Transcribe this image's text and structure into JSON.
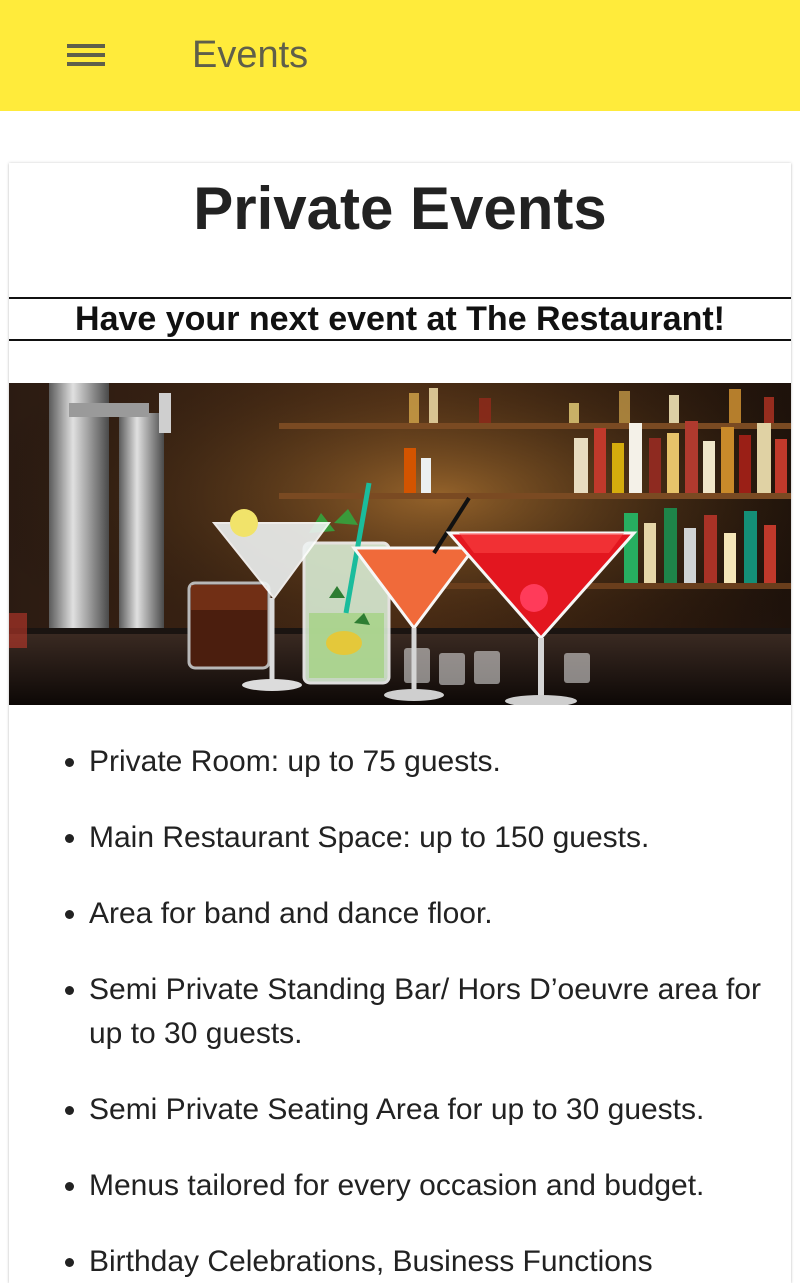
{
  "appbar": {
    "title": "Events",
    "bg_color": "#ffeb3b",
    "menu_icon": "hamburger-menu-icon"
  },
  "page": {
    "title": "Private Events",
    "subtitle": "Have your next event at The Restaurant!"
  },
  "features": [
    "Private Room: up to 75 guests.",
    "Main Restaurant Space: up to 150 guests.",
    "Area for band and dance floor.",
    "Semi Private Standing Bar/ Hors D’oeuvre area for up to 30 guests.",
    "Semi Private Seating Area for up to 30 guests.",
    "Menus tailored for every occasion and budget.",
    "Birthday Celebrations, Business Functions"
  ]
}
